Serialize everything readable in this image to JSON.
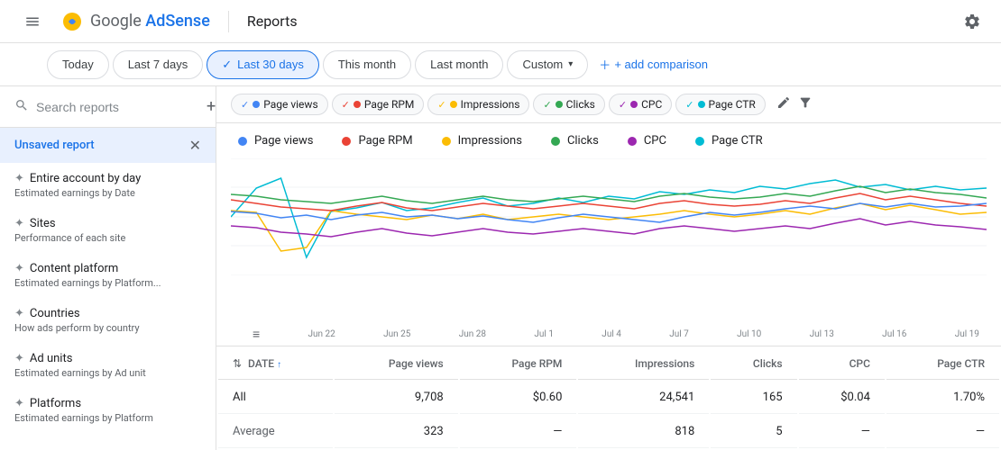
{
  "topbar": {
    "logo_text": "Google",
    "logo_product": "AdSense",
    "divider": true,
    "title": "Reports",
    "gear_icon": "⚙"
  },
  "filterbar": {
    "buttons": [
      {
        "id": "today",
        "label": "Today",
        "active": false
      },
      {
        "id": "last7",
        "label": "Last 7 days",
        "active": false
      },
      {
        "id": "last30",
        "label": "Last 30 days",
        "active": true,
        "check": "✓"
      },
      {
        "id": "thismonth",
        "label": "This month",
        "active": false
      },
      {
        "id": "lastmonth",
        "label": "Last month",
        "active": false
      },
      {
        "id": "custom",
        "label": "Custom",
        "active": false,
        "dropdown": true
      }
    ],
    "add_comparison": "+ add comparison"
  },
  "sidebar": {
    "search_placeholder": "Search reports",
    "add_icon": "+",
    "active_item": {
      "label": "Unsaved report",
      "close": "✕"
    },
    "items": [
      {
        "id": "entire-account",
        "name": "Entire account by day",
        "desc": "Estimated earnings by Date",
        "has_more": true
      },
      {
        "id": "sites",
        "name": "Sites",
        "desc": "Performance of each site",
        "has_more": true
      },
      {
        "id": "content-platform",
        "name": "Content platform",
        "desc": "Estimated earnings by Platform...",
        "has_more": true
      },
      {
        "id": "countries",
        "name": "Countries",
        "desc": "How ads perform by country",
        "has_more": true
      },
      {
        "id": "ad-units",
        "name": "Ad units",
        "desc": "Estimated earnings by Ad unit",
        "has_more": true
      },
      {
        "id": "platforms",
        "name": "Platforms",
        "desc": "Estimated earnings by Platform",
        "has_more": true
      }
    ]
  },
  "chart_tabs": [
    {
      "id": "page-views",
      "label": "Page views",
      "color": "#4285f4",
      "active": true
    },
    {
      "id": "page-rpm",
      "label": "Page RPM",
      "color": "#ea4335",
      "active": true
    },
    {
      "id": "impressions",
      "label": "Impressions",
      "color": "#fbbc04",
      "active": true
    },
    {
      "id": "clicks",
      "label": "Clicks",
      "color": "#34a853",
      "active": true
    },
    {
      "id": "cpc",
      "label": "CPC",
      "color": "#9c27b0",
      "active": true
    },
    {
      "id": "page-ctr",
      "label": "Page CTR",
      "color": "#00bcd4",
      "active": true
    }
  ],
  "chart_legend": [
    {
      "label": "Page views",
      "color": "#4285f4"
    },
    {
      "label": "Page RPM",
      "color": "#ea4335"
    },
    {
      "label": "Impressions",
      "color": "#fbbc04"
    },
    {
      "label": "Clicks",
      "color": "#34a853"
    },
    {
      "label": "CPC",
      "color": "#9c27b0"
    },
    {
      "label": "Page CTR",
      "color": "#00bcd4"
    }
  ],
  "date_axis": [
    "Jun 22",
    "Jun 25",
    "Jun 28",
    "Jul 1",
    "Jul 4",
    "Jul 7",
    "Jul 10",
    "Jul 13",
    "Jul 16",
    "Jul 19"
  ],
  "table": {
    "columns": [
      {
        "id": "date",
        "label": "DATE",
        "sort": true
      },
      {
        "id": "page-views",
        "label": "Page views"
      },
      {
        "id": "page-rpm",
        "label": "Page RPM"
      },
      {
        "id": "impressions",
        "label": "Impressions"
      },
      {
        "id": "clicks",
        "label": "Clicks"
      },
      {
        "id": "cpc",
        "label": "CPC"
      },
      {
        "id": "page-ctr",
        "label": "Page CTR"
      }
    ],
    "rows": [
      {
        "date": "All",
        "page_views": "9,708",
        "page_rpm": "$0.60",
        "impressions": "24,541",
        "clicks": "165",
        "cpc": "$0.04",
        "page_ctr": "1.70%"
      },
      {
        "date": "Average",
        "page_views": "323",
        "page_rpm": "—",
        "impressions": "818",
        "clicks": "5",
        "cpc": "—",
        "page_ctr": "—"
      }
    ]
  },
  "chart": {
    "lines": {
      "page_views": {
        "color": "#4285f4",
        "points": [
          0.55,
          0.52,
          0.48,
          0.5,
          0.47,
          0.48,
          0.46,
          0.44,
          0.47,
          0.46,
          0.48,
          0.45,
          0.43,
          0.47,
          0.5,
          0.48,
          0.46,
          0.44,
          0.48,
          0.52,
          0.55,
          0.58,
          0.54,
          0.56,
          0.6,
          0.64,
          0.58,
          0.62,
          0.66,
          0.7
        ]
      },
      "page_rpm": {
        "color": "#ea4335",
        "points": [
          0.65,
          0.6,
          0.55,
          0.52,
          0.5,
          0.55,
          0.58,
          0.52,
          0.5,
          0.53,
          0.56,
          0.54,
          0.52,
          0.55,
          0.57,
          0.55,
          0.53,
          0.56,
          0.6,
          0.58,
          0.56,
          0.59,
          0.62,
          0.6,
          0.64,
          0.68,
          0.63,
          0.67,
          0.63,
          0.6
        ]
      },
      "impressions": {
        "color": "#fbbc04",
        "points": [
          0.6,
          0.58,
          0.2,
          0.25,
          0.55,
          0.52,
          0.5,
          0.48,
          0.52,
          0.5,
          0.53,
          0.51,
          0.5,
          0.53,
          0.55,
          0.53,
          0.51,
          0.54,
          0.58,
          0.56,
          0.54,
          0.57,
          0.6,
          0.58,
          0.62,
          0.65,
          0.6,
          0.64,
          0.6,
          0.58
        ]
      },
      "clicks": {
        "color": "#34a853",
        "points": [
          0.72,
          0.7,
          0.65,
          0.62,
          0.6,
          0.65,
          0.68,
          0.62,
          0.6,
          0.63,
          0.66,
          0.64,
          0.62,
          0.65,
          0.67,
          0.65,
          0.63,
          0.66,
          0.7,
          0.68,
          0.66,
          0.69,
          0.72,
          0.7,
          0.74,
          0.78,
          0.73,
          0.77,
          0.73,
          0.7
        ]
      },
      "cpc": {
        "color": "#9c27b0",
        "points": [
          0.45,
          0.43,
          0.38,
          0.36,
          0.34,
          0.38,
          0.4,
          0.35,
          0.33,
          0.36,
          0.38,
          0.37,
          0.35,
          0.38,
          0.4,
          0.38,
          0.36,
          0.39,
          0.42,
          0.4,
          0.38,
          0.41,
          0.44,
          0.42,
          0.46,
          0.5,
          0.45,
          0.49,
          0.45,
          0.42
        ]
      },
      "page_ctr": {
        "color": "#00bcd4",
        "points": [
          0.5,
          0.75,
          0.85,
          0.15,
          0.55,
          0.58,
          0.62,
          0.56,
          0.58,
          0.62,
          0.65,
          0.6,
          0.58,
          0.62,
          0.65,
          0.62,
          0.6,
          0.64,
          0.68,
          0.66,
          0.64,
          0.67,
          0.7,
          0.68,
          0.72,
          0.75,
          0.7,
          0.74,
          0.7,
          0.68
        ]
      }
    }
  }
}
